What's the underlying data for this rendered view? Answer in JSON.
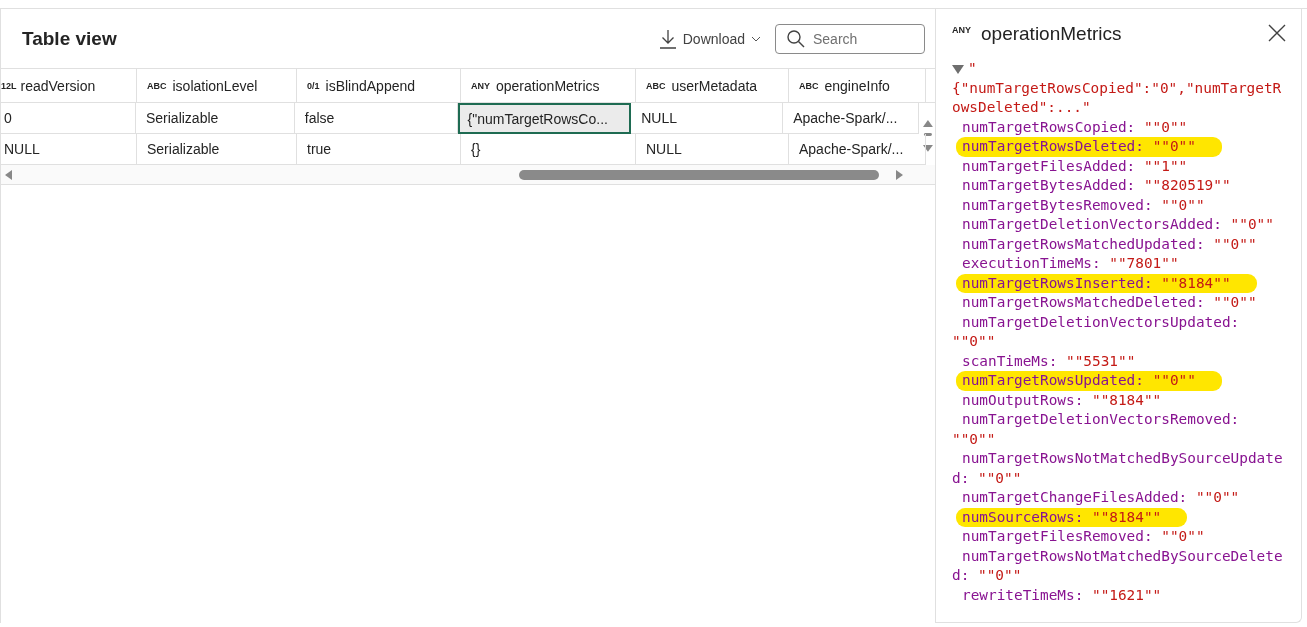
{
  "table_view": {
    "title": "Table view",
    "download_button": {
      "label": "Download"
    },
    "search": {
      "placeholder": "Search"
    },
    "table": {
      "columns": [
        {
          "type_label": "12L",
          "name": "readVersion"
        },
        {
          "type_label": "ABC",
          "name": "isolationLevel"
        },
        {
          "type_label": "0/1",
          "name": "isBlindAppend"
        },
        {
          "type_label": "ANY",
          "name": "operationMetrics"
        },
        {
          "type_label": "ABC",
          "name": "userMetadata"
        },
        {
          "type_label": "ABC",
          "name": "engineInfo"
        }
      ],
      "rows": [
        {
          "cells": [
            {
              "text": "0",
              "selected": false
            },
            {
              "text": "Serializable",
              "selected": false
            },
            {
              "text": "false",
              "selected": false
            },
            {
              "text": "{\"numTargetRowsCo...",
              "selected": true
            },
            {
              "text": "NULL",
              "selected": false
            },
            {
              "text": "Apache-Spark/...",
              "selected": false
            }
          ]
        },
        {
          "cells": [
            {
              "text": "NULL",
              "selected": false
            },
            {
              "text": "Serializable",
              "selected": false
            },
            {
              "text": "true",
              "selected": false
            },
            {
              "text": "{}",
              "selected": false
            },
            {
              "text": "NULL",
              "selected": false
            },
            {
              "text": "Apache-Spark/...",
              "selected": false
            }
          ]
        }
      ]
    }
  },
  "detail_panel": {
    "type_label": "ANY",
    "title": "operationMetrics",
    "tree": {
      "expanded": true,
      "quote": "\"",
      "summary": "{\"numTargetRowsCopied\":\"0\",\"numTargetRowsDeleted\":...\"",
      "entries": [
        {
          "key": "numTargetRowsCopied:",
          "value": "\"\"0\"\"",
          "highlighted": false
        },
        {
          "key": "numTargetRowsDeleted:",
          "value": "\"\"0\"\"",
          "highlighted": true
        },
        {
          "key": "numTargetFilesAdded:",
          "value": "\"\"1\"\"",
          "highlighted": false
        },
        {
          "key": "numTargetBytesAdded:",
          "value": "\"\"820519\"\"",
          "highlighted": false
        },
        {
          "key": "numTargetBytesRemoved:",
          "value": "\"\"0\"\"",
          "highlighted": false
        },
        {
          "key": "numTargetDeletionVectorsAdded:",
          "value": "\"\"0\"\"",
          "highlighted": false
        },
        {
          "key": "numTargetRowsMatchedUpdated:",
          "value": "\"\"0\"\"",
          "highlighted": false
        },
        {
          "key": "executionTimeMs:",
          "value": "\"\"7801\"\"",
          "highlighted": false
        },
        {
          "key": "numTargetRowsInserted:",
          "value": "\"\"8184\"\"",
          "highlighted": true
        },
        {
          "key": "numTargetRowsMatchedDeleted:",
          "value": "\"\"0\"\"",
          "highlighted": false
        },
        {
          "key": "numTargetDeletionVectorsUpdated:",
          "value": "\"\"0\"\"",
          "highlighted": false
        },
        {
          "key": "scanTimeMs:",
          "value": "\"\"5531\"\"",
          "highlighted": false
        },
        {
          "key": "numTargetRowsUpdated:",
          "value": "\"\"0\"\"",
          "highlighted": true
        },
        {
          "key": "numOutputRows:",
          "value": "\"\"8184\"\"",
          "highlighted": false
        },
        {
          "key": "numTargetDeletionVectorsRemoved:",
          "value": "\"\"0\"\"",
          "highlighted": false
        },
        {
          "key": "numTargetRowsNotMatchedBySourceUpdated:",
          "value": "\"\"0\"\"",
          "highlighted": false
        },
        {
          "key": "numTargetChangeFilesAdded:",
          "value": "\"\"0\"\"",
          "highlighted": false
        },
        {
          "key": "numSourceRows:",
          "value": "\"\"8184\"\"",
          "highlighted": true
        },
        {
          "key": "numTargetFilesRemoved:",
          "value": "\"\"0\"\"",
          "highlighted": false
        },
        {
          "key": "numTargetRowsNotMatchedBySourceDeleted:",
          "value": "\"\"0\"\"",
          "highlighted": false
        },
        {
          "key": "rewriteTimeMs:",
          "value": "\"\"1621\"\"",
          "highlighted": false
        }
      ]
    }
  }
}
